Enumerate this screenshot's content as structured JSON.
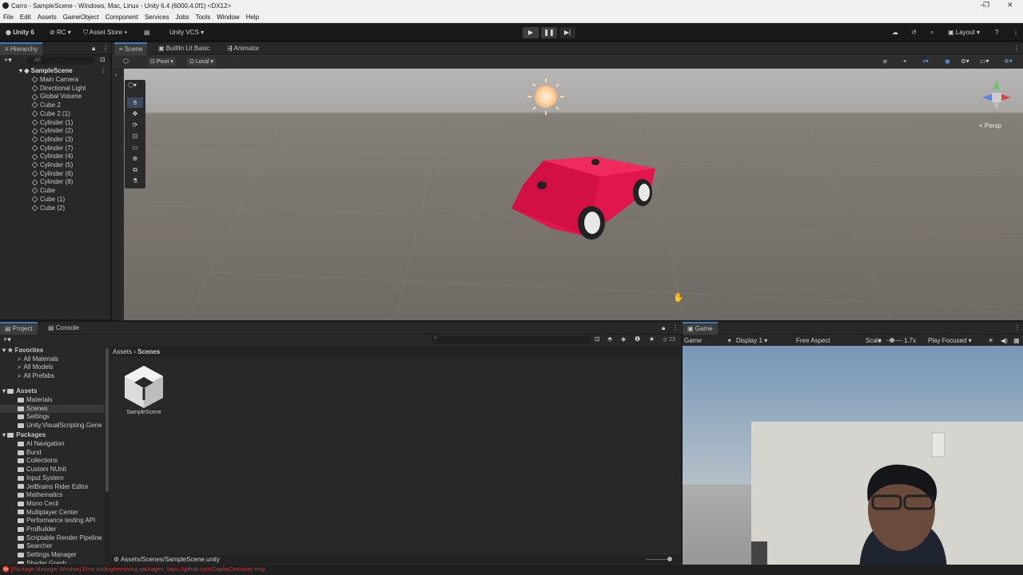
{
  "window": {
    "title": "Carro - SampleScene - Windows, Mac, Linux - Unity 6.4 (6000.4.0f1) <DX12>",
    "controls": [
      "─",
      "❐",
      "✕"
    ]
  },
  "menu": [
    "File",
    "Edit",
    "Assets",
    "GameObject",
    "Component",
    "Services",
    "Jobs",
    "Tools",
    "Window",
    "Help"
  ],
  "toolbar": {
    "unity_label": "Unity 6",
    "rc_label": "RC",
    "asset_store_label": "Asset Store",
    "vcs_label": "Unity VCS",
    "layout_label": "Layout"
  },
  "hierarchy": {
    "tab": "Hierarchy",
    "search_placeholder": "All",
    "scene": "SampleScene",
    "items": [
      "Main Camera",
      "Directional Light",
      "Global Volume",
      "Cube 2",
      "Cube 2 (1)",
      "Cylinder (1)",
      "Cylinder (2)",
      "Cylinder (3)",
      "Cylinder (7)",
      "Cylinder (4)",
      "Cylinder (5)",
      "Cylinder (6)",
      "Cylinder (8)",
      "Cube",
      "Cube (1)",
      "Cube (2)"
    ]
  },
  "scene_tabs": [
    "Scene",
    "BuiltIn Lit Basic",
    "Animator"
  ],
  "scene_toolbar": {
    "pivot": "Pivot",
    "local": "Local"
  },
  "scene": {
    "persp_label": "< Persp"
  },
  "project": {
    "tabs": [
      "Project",
      "Console"
    ],
    "breadcrumb": [
      "Assets",
      "Scenes"
    ],
    "favorites_label": "Favorites",
    "favorites": [
      "All Materials",
      "All Models",
      "All Prefabs"
    ],
    "assets_label": "Assets",
    "assets": [
      "Materials",
      "Scenes",
      "Settings",
      "Unity.VisualScripting.Gene"
    ],
    "packages_label": "Packages",
    "packages": [
      "AI Navigation",
      "Burst",
      "Collections",
      "Custom NUnit",
      "Input System",
      "JetBrains Rider Editor",
      "Mathematics",
      "Mono Cecil",
      "Multiplayer Center",
      "Performance testing API",
      "ProBuilder",
      "Scriptable Render Pipeline",
      "Searcher",
      "Settings Manager",
      "Shader Graph"
    ],
    "asset_item": "SampleScene",
    "footer_path": "Assets/Scenes/SampleScene.unity",
    "count": "23"
  },
  "game": {
    "tab": "Game",
    "mode": "Game",
    "display": "Display 1",
    "aspect": "Free Aspect",
    "scale_label": "Scale",
    "scale_value": "1.7x",
    "play_focused": "Play Focused"
  },
  "status": {
    "message": "[Package Manager Window] Error adding/removing packages: https://github.com/CoplayDev/unity-mcp",
    "error_color": "#c83a3a"
  },
  "colors": {
    "car_body": "#e0164c",
    "accent_tab": "#3a79bb"
  }
}
